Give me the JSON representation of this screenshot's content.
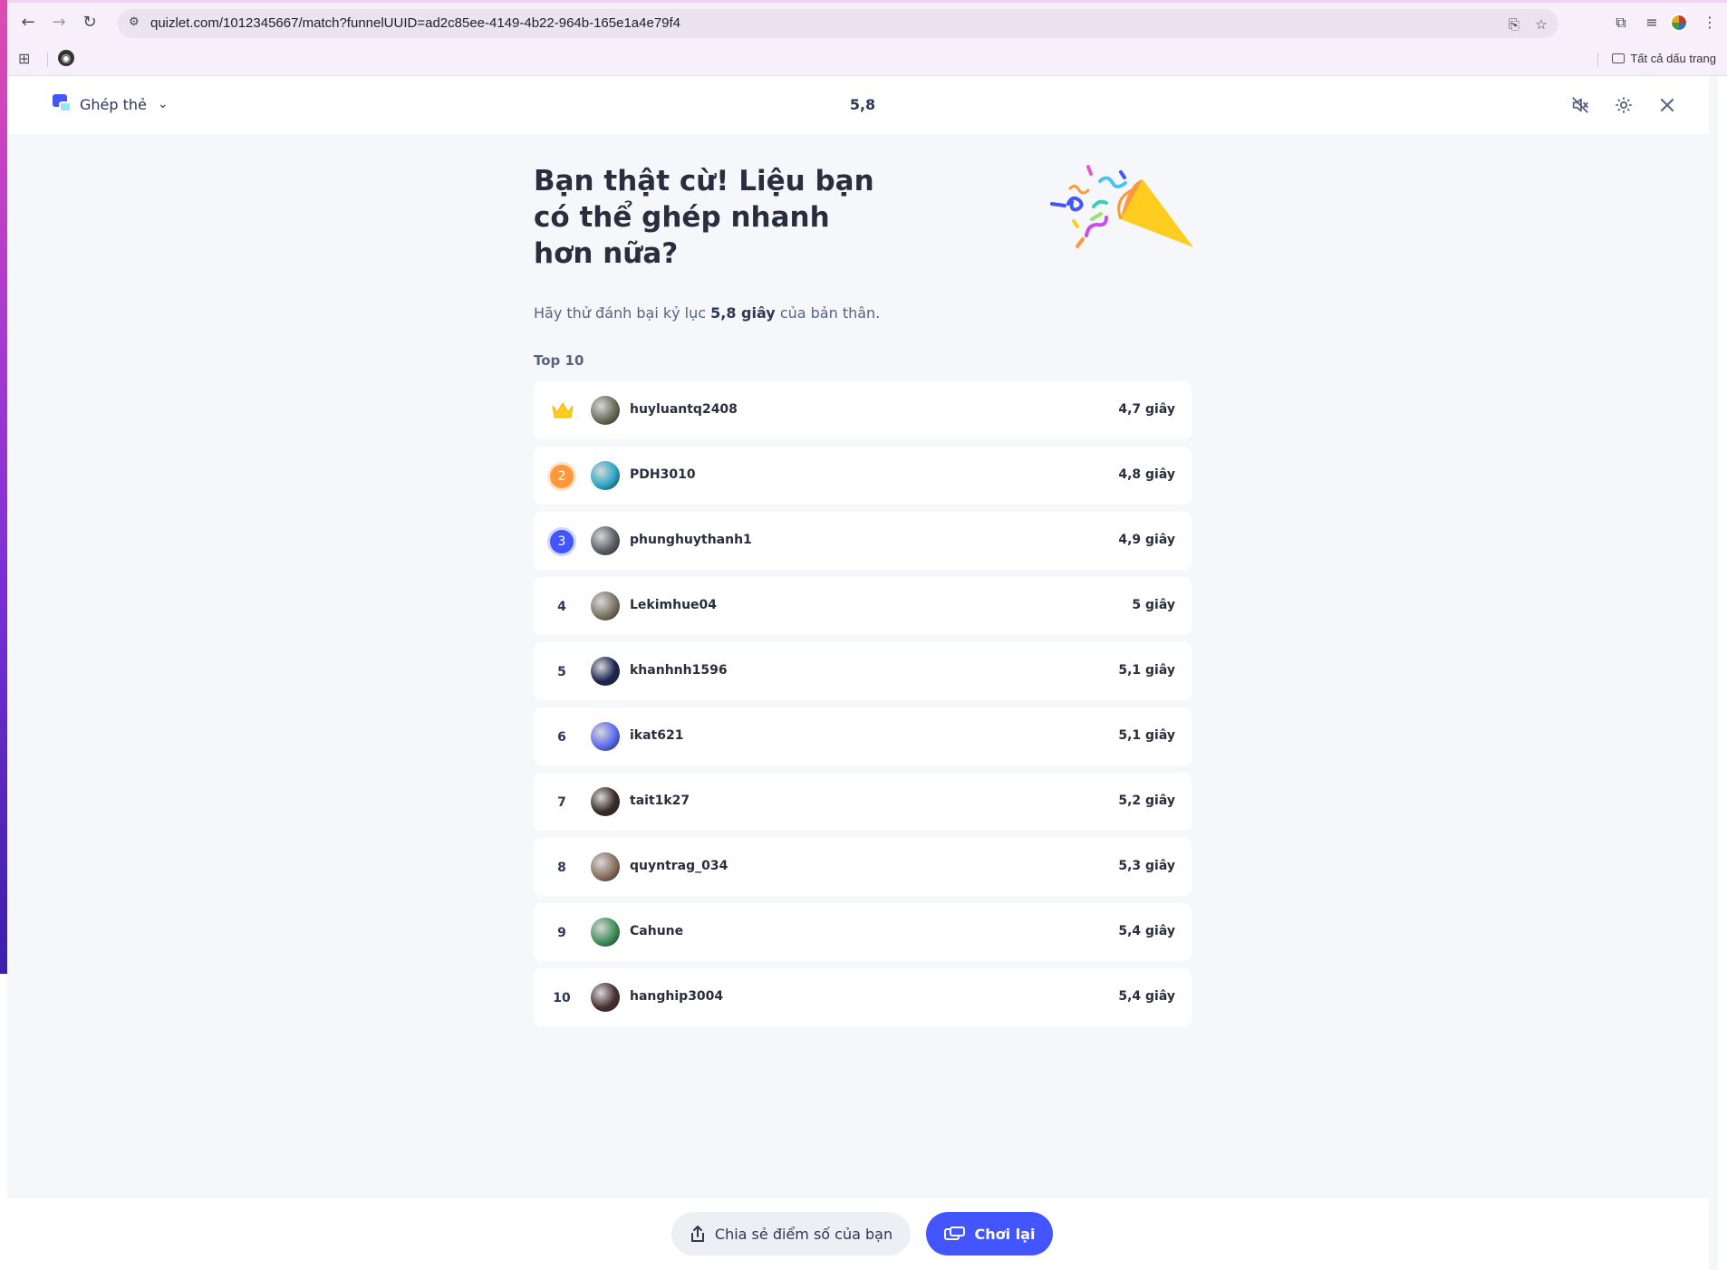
{
  "browser": {
    "url": "quizlet.com/1012345667/match?funnelUUID=ad2c85ee-4149-4b22-964b-165e1a4e79f4",
    "bookmarks_label": "Tất cả dấu trang"
  },
  "header": {
    "mode_label": "Ghép thẻ",
    "timer": "5,8"
  },
  "result": {
    "headline": "Bạn thật cừ! Liệu bạn có thể ghép nhanh hơn nữa?",
    "sub_prefix": "Hãy thử đánh bại kỷ lục ",
    "sub_record": "5,8 giây",
    "sub_suffix": " của bản thân.",
    "top_title": "Top 10"
  },
  "leaderboard": [
    {
      "rank": "1",
      "name": "huyluantq2408",
      "time": "4,7 giây",
      "avatar_color": "#6b6b5a"
    },
    {
      "rank": "2",
      "name": "PDH3010",
      "time": "4,8 giây",
      "avatar_color": "#2aa7c7"
    },
    {
      "rank": "3",
      "name": "phunghuythanh1",
      "time": "4,9 giây",
      "avatar_color": "#5a5f66"
    },
    {
      "rank": "4",
      "name": "Lekimhue04",
      "time": "5 giây",
      "avatar_color": "#7d7466"
    },
    {
      "rank": "5",
      "name": "khanhnh1596",
      "time": "5,1 giây",
      "avatar_color": "#1c2450"
    },
    {
      "rank": "6",
      "name": "ikat621",
      "time": "5,1 giây",
      "avatar_color": "#5b6cf2"
    },
    {
      "rank": "7",
      "name": "tait1k27",
      "time": "5,2 giây",
      "avatar_color": "#3a2a24"
    },
    {
      "rank": "8",
      "name": "quyntrag_034",
      "time": "5,3 giây",
      "avatar_color": "#8a7060"
    },
    {
      "rank": "9",
      "name": "Cahune",
      "time": "5,4 giây",
      "avatar_color": "#3e8f5a"
    },
    {
      "rank": "10",
      "name": "hanghip3004",
      "time": "5,4 giây",
      "avatar_color": "#4a2f2f"
    }
  ],
  "footer": {
    "share_label": "Chia sẻ điểm số của bạn",
    "play_again_label": "Chơi lại"
  },
  "colors": {
    "primary": "#4255ff",
    "medal_silver": "#ff983a",
    "medal_bronze": "#4255ff",
    "crown": "#ffcd1f"
  },
  "icons": [
    "back-arrow-icon",
    "forward-arrow-icon",
    "reload-icon",
    "site-settings-icon",
    "install-app-icon",
    "star-icon",
    "extensions-icon",
    "media-icon",
    "menu-icon",
    "apps-icon",
    "globe-icon",
    "folder-icon",
    "mode-icon",
    "chevron-down-icon",
    "mute-icon",
    "settings-icon",
    "close-icon",
    "confetti-icon",
    "crown-icon",
    "share-icon",
    "play-again-icon"
  ]
}
